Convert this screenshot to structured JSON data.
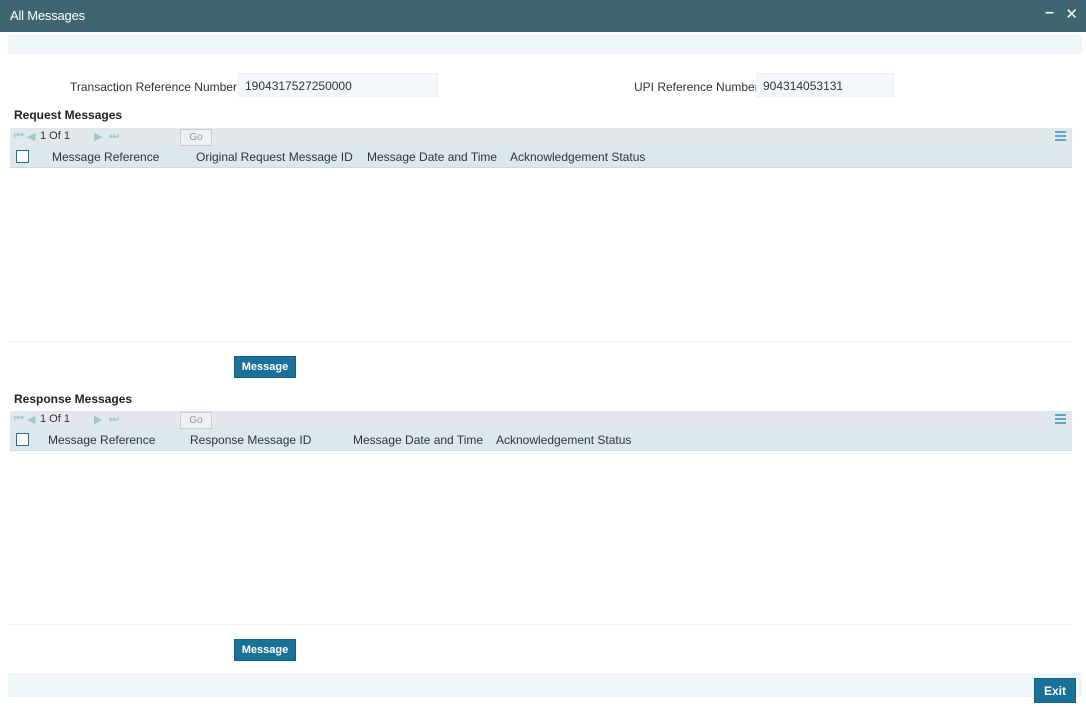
{
  "window": {
    "title": "All Messages",
    "minimize_glyph": "–",
    "close_glyph": "✕"
  },
  "header": {
    "txn_ref_label": "Transaction Reference Number",
    "txn_ref_value": "1904317527250000",
    "upi_ref_label": "UPI Reference Number",
    "upi_ref_value": "904314053131"
  },
  "request_messages": {
    "title": "Request Messages",
    "pager": {
      "first": "⏮",
      "prev": "◀",
      "page_text": "1 Of 1",
      "next": "▶",
      "last": "⏭",
      "go_label": "Go"
    },
    "columns": [
      "Message Reference",
      "Original Request Message ID",
      "Message Date and Time",
      "Acknowledgement Status"
    ],
    "rows": [],
    "button_label": "Message"
  },
  "response_messages": {
    "title": "Response Messages",
    "pager": {
      "first": "⏮",
      "prev": "◀",
      "page_text": "1 Of 1",
      "next": "▶",
      "last": "⏭",
      "go_label": "Go"
    },
    "columns": [
      "Message Reference",
      "Response Message ID",
      "Message Date and Time",
      "Acknowledgement Status"
    ],
    "rows": [],
    "button_label": "Message"
  },
  "footer": {
    "exit_label": "Exit"
  },
  "colors": {
    "titlebar": "#3d6670",
    "accent_button": "#1b7298",
    "grid_header": "#dbe9ef",
    "pager_bg": "#e3e8ec",
    "strip_bg": "#eef6f8"
  },
  "icons": {
    "column_settings": "list-icon",
    "first_page": "first-page-icon",
    "prev_page": "prev-page-icon",
    "next_page": "next-page-icon",
    "last_page": "last-page-icon"
  }
}
